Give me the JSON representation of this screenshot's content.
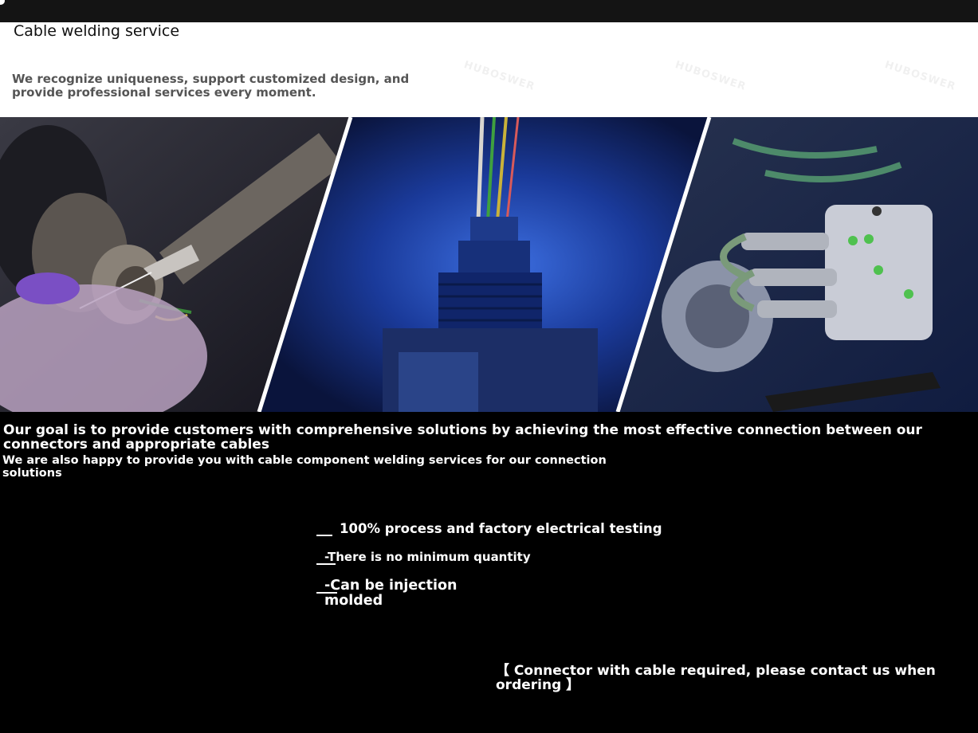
{
  "header": {
    "title": "Cable welding service",
    "subtitle": "We recognize uniqueness, support customized design, and provide professional services every moment."
  },
  "banner": {
    "panels": [
      "soldering-connector-photo",
      "connector-wiring-photo",
      "motor-connector-photo"
    ]
  },
  "content": {
    "goal": "Our goal is to provide customers with comprehensive solutions by achieving the most effective connection between our connectors and appropriate cables",
    "note": "We are also happy to provide you with cable component welding services for our connection solutions"
  },
  "features": [
    {
      "text": "100% process and factory electrical testing"
    },
    {
      "text": "-There is no minimum quantity"
    },
    {
      "text": "-Can be injection molded"
    }
  ],
  "contact": {
    "text": "【 Connector with cable required, please contact us when ordering 】"
  },
  "colors": {
    "background": "#000000",
    "header_background": "#ffffff",
    "text": "#ffffff"
  }
}
